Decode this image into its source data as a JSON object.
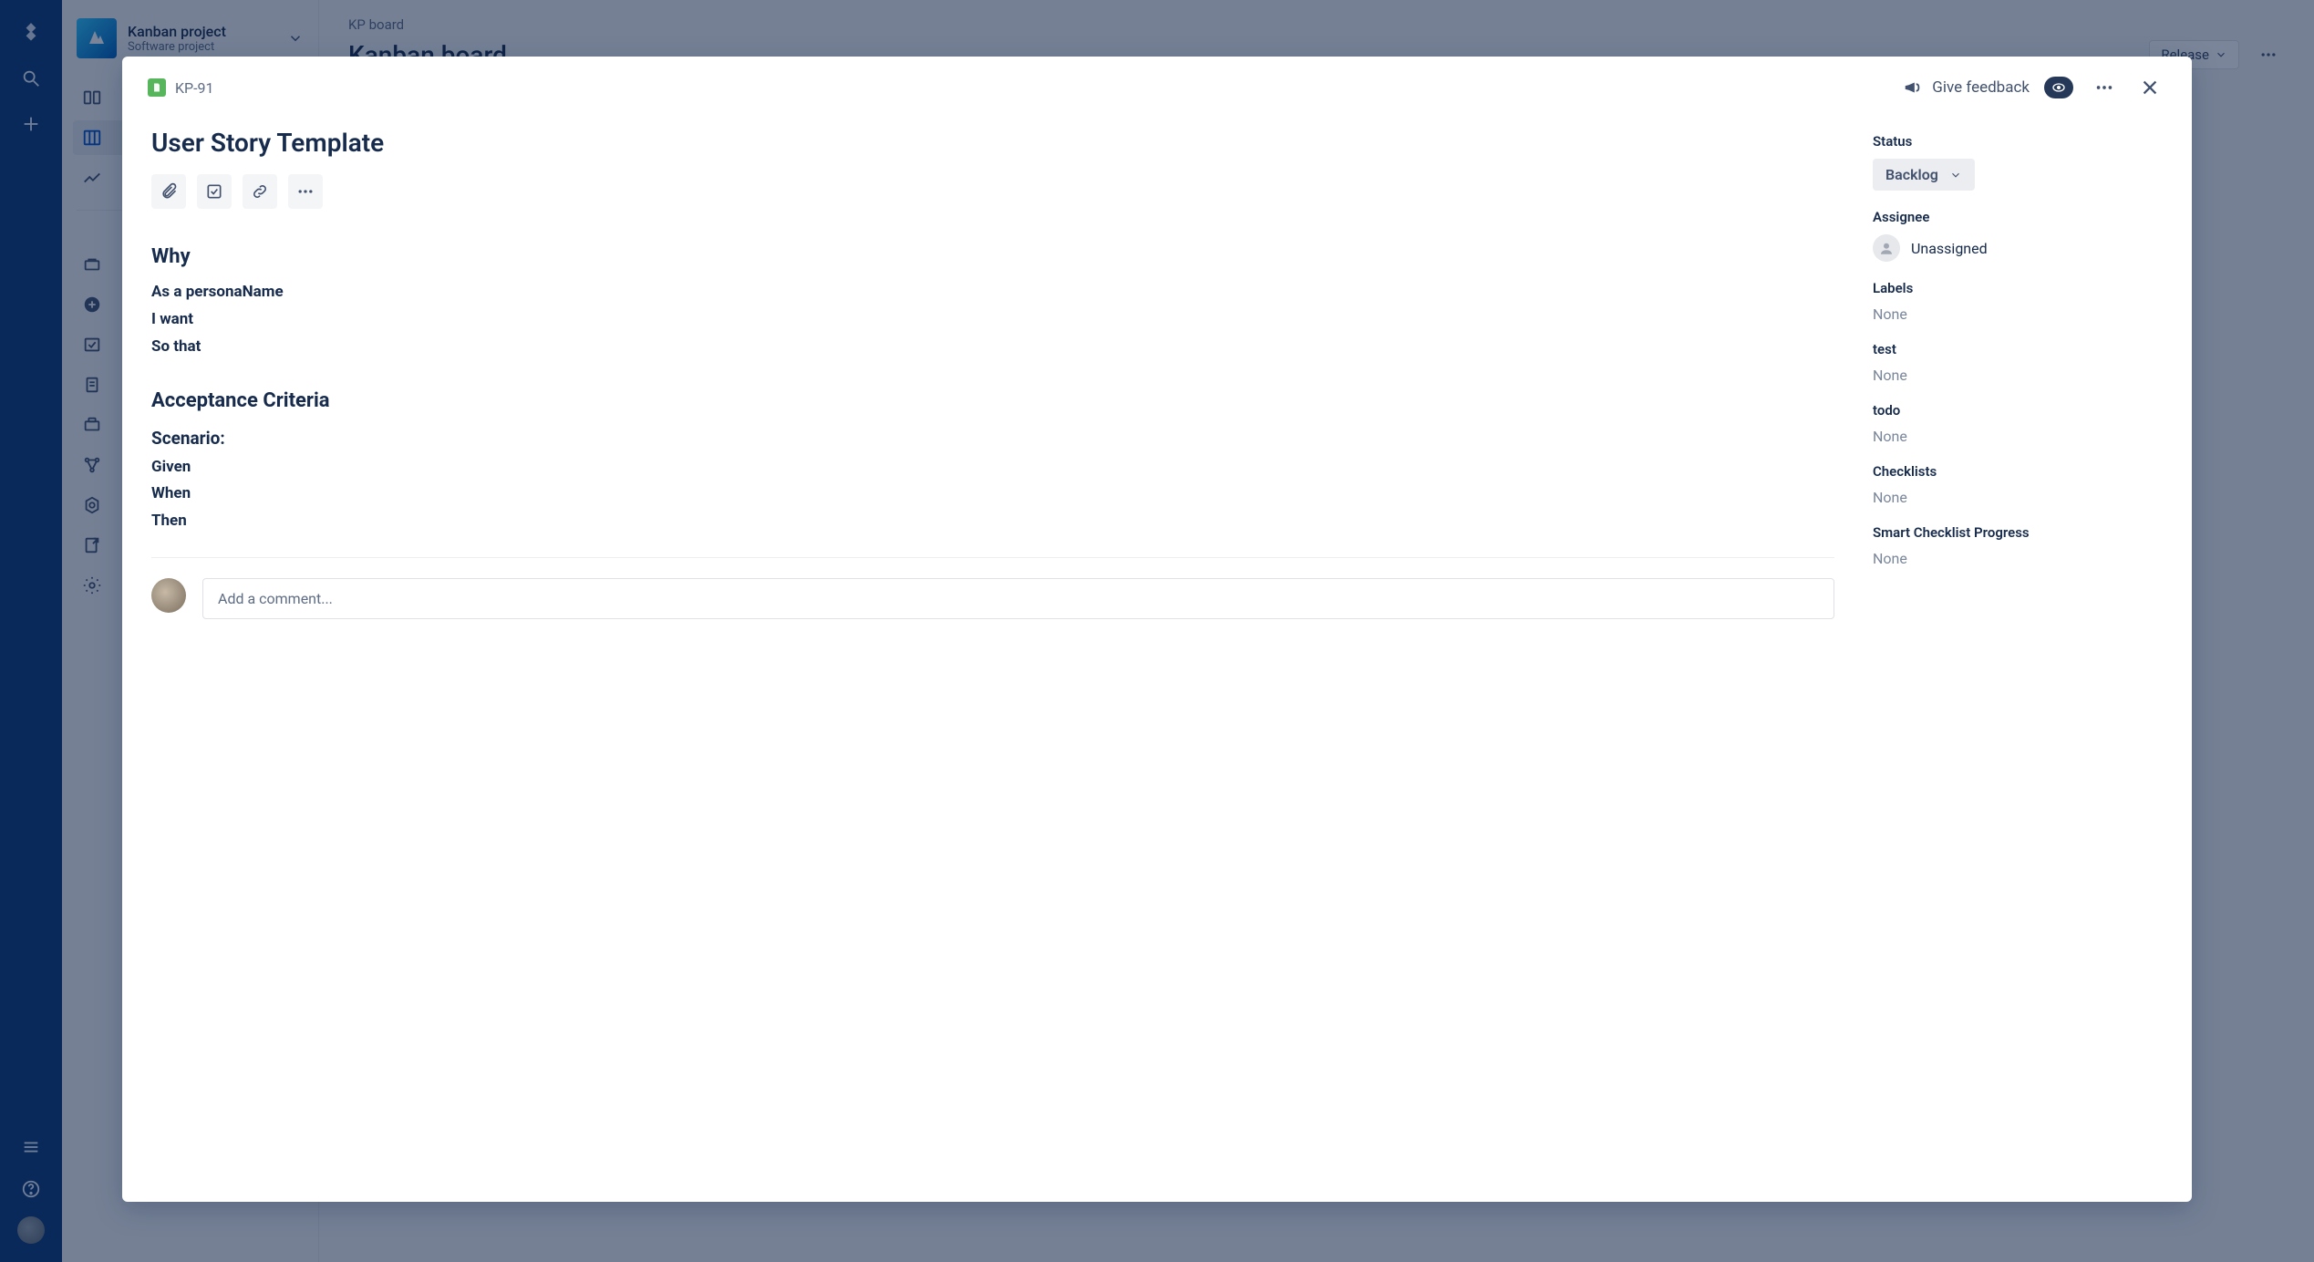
{
  "rail": {
    "items_top": [
      {
        "name": "jira-logo-icon"
      },
      {
        "name": "search-icon"
      },
      {
        "name": "plus-icon"
      }
    ],
    "items_bottom": [
      {
        "name": "menu-icon"
      },
      {
        "name": "help-icon"
      },
      {
        "name": "profile-avatar"
      }
    ]
  },
  "project": {
    "name": "Kanban project",
    "type": "Software project",
    "chevron": true
  },
  "sidebar": {
    "groups": [
      [
        {
          "name": "roadmap",
          "icon": "roadmap-icon"
        },
        {
          "name": "board",
          "icon": "board-icon",
          "active": true
        },
        {
          "name": "reports",
          "icon": "reports-icon"
        }
      ],
      [
        {
          "name": "releases",
          "icon": "releases-icon"
        },
        {
          "name": "add-item",
          "icon": "add-circle-icon"
        },
        {
          "name": "issues",
          "icon": "issue-icon"
        },
        {
          "name": "pages",
          "icon": "page-icon"
        },
        {
          "name": "components",
          "icon": "components-icon"
        },
        {
          "name": "nodes",
          "icon": "nodes-icon"
        },
        {
          "name": "cog",
          "icon": "cog-icon"
        },
        {
          "name": "shortcut",
          "icon": "shortcut-icon"
        },
        {
          "name": "settings",
          "icon": "gear-icon"
        }
      ]
    ]
  },
  "page": {
    "breadcrumb": "KP board",
    "title": "Kanban board",
    "release_label": "Release"
  },
  "modal": {
    "issue_key": "KP-91",
    "feedback": "Give feedback",
    "title": "User Story Template",
    "toolbar": [
      "attach-icon",
      "subtask-icon",
      "link-icon",
      "more-icon"
    ],
    "description": {
      "why_heading": "Why",
      "line1": "As a personaName",
      "line2": "I want",
      "line3": "So that",
      "ac_heading": "Acceptance Criteria",
      "scenario_heading": "Scenario:",
      "given": "Given",
      "when": "When",
      "then": "Then"
    },
    "comment_placeholder": "Add a comment...",
    "right": {
      "status_label": "Status",
      "status_value": "Backlog",
      "fields": [
        {
          "label": "Assignee",
          "value": "Unassigned",
          "type": "assignee"
        },
        {
          "label": "Labels",
          "value": "None",
          "type": "none"
        },
        {
          "label": "test",
          "value": "None",
          "type": "none"
        },
        {
          "label": "todo",
          "value": "None",
          "type": "none"
        },
        {
          "label": "Checklists",
          "value": "None",
          "type": "none"
        },
        {
          "label": "Smart Checklist Progress",
          "value": "None",
          "type": "none"
        }
      ]
    }
  }
}
